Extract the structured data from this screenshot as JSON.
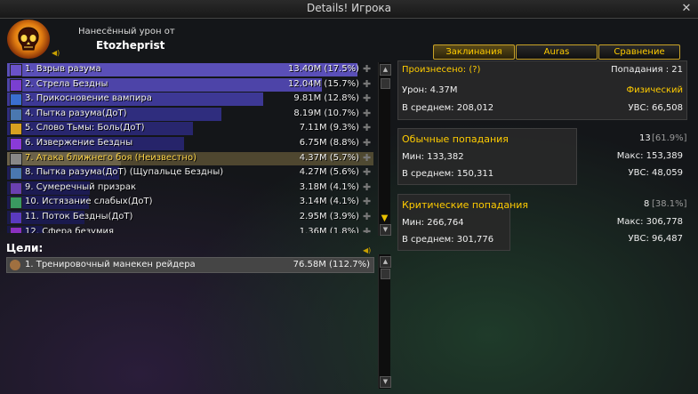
{
  "window": {
    "title": "Details! Игрока",
    "close_glyph": "✕"
  },
  "header": {
    "caption": "Нанесённый урон от",
    "player": "Etozheprist",
    "icon": "burning-skull-icon"
  },
  "tabs": [
    {
      "label": "Заклинания",
      "active": true
    },
    {
      "label": "Auras",
      "active": false
    },
    {
      "label": "Сравнение",
      "active": false
    }
  ],
  "spells": [
    {
      "label": "1. Взрыв разума",
      "value": "13.40M (17.5%)",
      "pct": 100,
      "color": "#5a4fb8",
      "icon": "mind-blast-icon",
      "icon_color": "#6a52c8"
    },
    {
      "label": "2. Стрела Бездны",
      "value": "12.04M (15.7%)",
      "pct": 89.9,
      "color": "#4d44a8",
      "icon": "void-bolt-icon",
      "icon_color": "#7a3fd0"
    },
    {
      "label": "3. Прикосновение вампира",
      "value": "9.81M (12.8%)",
      "pct": 73.2,
      "color": "#3d3895",
      "icon": "vampiric-touch-icon",
      "icon_color": "#3a6fd0"
    },
    {
      "label": "4. Пытка разума(ДоТ)",
      "value": "8.19M (10.7%)",
      "pct": 61.1,
      "color": "#2f2d7e",
      "icon": "mind-flay-icon",
      "icon_color": "#4a78b0"
    },
    {
      "label": "5. Слово Тьмы: Боль(ДоТ)",
      "value": "7.11M (9.3%)",
      "pct": 53.1,
      "color": "#28266e",
      "icon": "shadow-word-pain-icon",
      "icon_color": "#d8a020"
    },
    {
      "label": "6. Извержение Бездны",
      "value": "6.75M (8.8%)",
      "pct": 50.4,
      "color": "#26246a",
      "icon": "void-eruption-icon",
      "icon_color": "#8a3ad8"
    },
    {
      "label": "7. Атака ближнего боя (Неизвестно)",
      "value": "4.37M (5.7%)",
      "pct": 32.6,
      "color": "#3a3a3a",
      "icon": "sword-icon",
      "icon_color": "#888888",
      "selected": true,
      "highlight": true
    },
    {
      "label": "8. Пытка разума(ДоТ) (Щупальце Бездны)",
      "value": "4.27M (5.6%)",
      "pct": 31.9,
      "color": "#1f1e5a",
      "icon": "mind-flay-icon",
      "icon_color": "#4a78b0"
    },
    {
      "label": "9. Сумеречный призрак",
      "value": "3.18M (4.1%)",
      "pct": 23.7,
      "color": "#1c1b52",
      "icon": "shadowy-apparition-icon",
      "icon_color": "#6a40b0"
    },
    {
      "label": "10. Истязание слабых(ДоТ)",
      "value": "3.14M (4.1%)",
      "pct": 23.4,
      "color": "#1c1b52",
      "icon": "torment-icon",
      "icon_color": "#3a9a60"
    },
    {
      "label": "11. Поток Бездны(ДоТ)",
      "value": "2.95M (3.9%)",
      "pct": 22.0,
      "color": "#1a1a4e",
      "icon": "void-torrent-icon",
      "icon_color": "#5a3ac0"
    },
    {
      "label": "12. Сфера безумия",
      "value": "1.36M (1.8%)",
      "pct": 10.1,
      "color": "#18184a",
      "icon": "shadow-orb-icon",
      "icon_color": "#8a30c0"
    }
  ],
  "targets": {
    "label": "Цели:",
    "items": [
      {
        "label": "1. Тренировочный манекен рейдера",
        "value": "76.58M (112.7%)"
      }
    ]
  },
  "summary": {
    "cast_label": "Произнесено: (?)",
    "hits_label": "Попадания : 21",
    "damage_label": "Урон: 4.37M",
    "school": "Физический",
    "average_label": "В среднем: 208,012",
    "dps_label": "УВС: 66,508"
  },
  "normal_hits": {
    "title": "Обычные попадания",
    "count": "13",
    "count_pct": "[61.9%]",
    "min_label": "Мин: 133,382",
    "max_label": "Макс: 153,389",
    "avg_label": "В среднем: 150,311",
    "dps_label": "УВС: 48,059"
  },
  "crit_hits": {
    "title": "Критические попадания",
    "count": "8",
    "count_pct": "[38.1%]",
    "min_label": "Мин: 266,764",
    "max_label": "Макс: 306,778",
    "avg_label": "В среднем: 301,776",
    "dps_label": "УВС: 96,487"
  },
  "colors": {
    "accent_gold": "#ffcc00",
    "school_green": "#3cff3c",
    "highlight_yellow": "#ffd64a"
  }
}
